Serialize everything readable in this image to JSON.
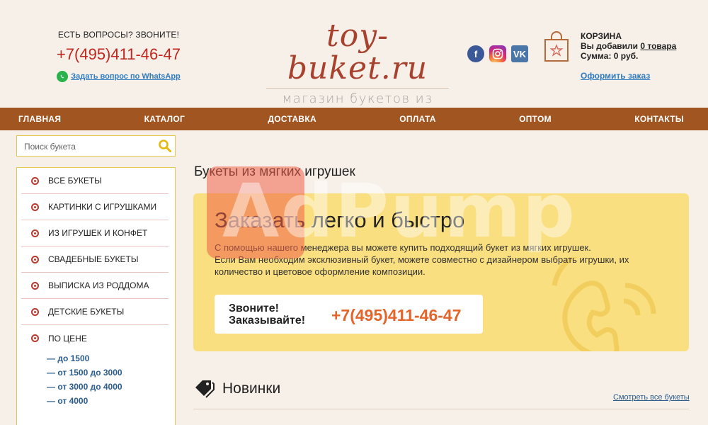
{
  "header": {
    "questions": "ЕСТЬ ВОПРОСЫ? ЗВОНИТЕ!",
    "phone": "+7(495)411-46-47",
    "whatsapp": "Задать вопрос по WhatsApp",
    "logo_brand": "toy-buket.ru",
    "logo_tagline": "магазин букетов из игрушек",
    "social": [
      "facebook-icon",
      "instagram-icon",
      "vk-icon"
    ],
    "cart_title": "КОРЗИНА",
    "cart_added_prefix": "Вы добавили ",
    "cart_added_link": "0 товара",
    "cart_sum": "Сумма: 0 руб.",
    "order_link": "Оформить заказ"
  },
  "nav": {
    "items": [
      "ГЛАВНАЯ",
      "КАТАЛОГ",
      "ДОСТАВКА",
      "ОПЛАТА",
      "ОПТОМ",
      "КОНТАКТЫ"
    ]
  },
  "search": {
    "placeholder": "Поиск букета"
  },
  "sidebar": {
    "items": [
      "ВСЕ БУКЕТЫ",
      "КАРТИНКИ С ИГРУШКАМИ",
      "ИЗ ИГРУШЕК И КОНФЕТ",
      "СВАДЕБНЫЕ БУКЕТЫ",
      "ВЫПИСКА ИЗ РОДДОМА",
      "ДЕТСКИЕ БУКЕТЫ",
      "ПО ЦЕНЕ"
    ],
    "price_ranges": [
      "— до 1500",
      "— от 1500 до 3000",
      "— от 3000 до 4000",
      "— от 4000"
    ]
  },
  "main": {
    "title": "Букеты из мягких игрушек",
    "promo_heading": "Заказать легко и быстро",
    "promo_line1": "С помощью нашего менеджера вы можете купить подходящий букет из мягких игрушек.",
    "promo_line2": "Если Вам необходим эксклюзивный букет, можете совместно с дизайнером выбрать игрушки, их количество и цветовое оформление композиции.",
    "call_line1": "Звоните!",
    "call_line2": "Заказывайте!",
    "call_phone": "+7(495)411-46-47",
    "new_title": "Новинки",
    "see_all": "Смотреть все букеты"
  },
  "watermark": "AdPump",
  "colors": {
    "nav_bg": "#a15521",
    "phone_red": "#c0271e",
    "promo_bg": "#f9df7f",
    "accent_orange": "#e3652a",
    "link_blue": "#2e7bbf"
  }
}
